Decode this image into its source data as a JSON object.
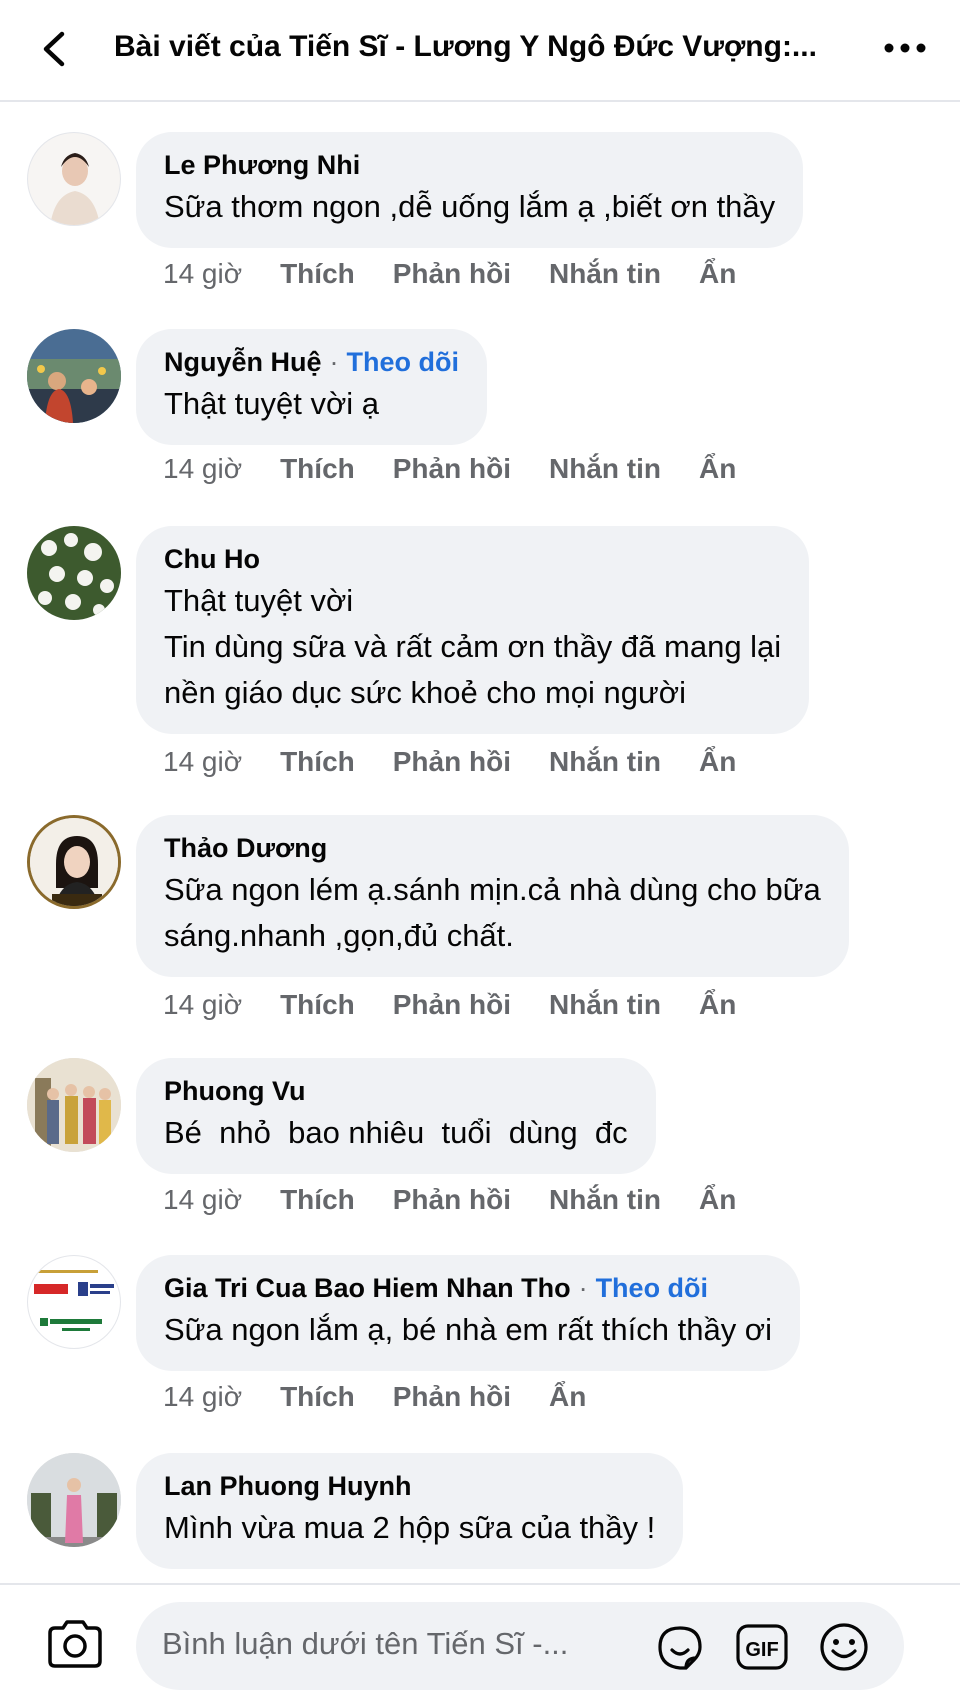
{
  "header": {
    "title": "Bài viết của Tiến Sĩ - Lương Y Ngô Đức Vượng:...",
    "back_icon": "chevron-left-icon",
    "more_icon": "more-dots-icon"
  },
  "actions": {
    "time": "14 giờ",
    "like": "Thích",
    "reply": "Phản hồi",
    "message": "Nhắn tin",
    "hide": "Ẩn"
  },
  "follow_label": "Theo dõi",
  "separator": "·",
  "comments": [
    {
      "name": "Le Phương Nhi",
      "lines": [
        "Sữa thơm ngon ,dễ uống lắm ạ ,biết ơn thầy"
      ]
    },
    {
      "name": "Nguyễn Huệ",
      "follow": true,
      "lines": [
        "Thật tuyệt vời ạ"
      ]
    },
    {
      "name": "Chu Ho",
      "lines": [
        "Thật tuyệt vời",
        "Tin dùng sữa và rất cảm ơn thầy đã mang lại",
        "nền giáo dục sức khoẻ cho mọi người"
      ]
    },
    {
      "name": "Thảo Dương",
      "lines": [
        "Sữa ngon lém ạ.sánh mịn.cả nhà dùng cho bữa",
        "sáng.nhanh ,gọn,đủ chất."
      ]
    },
    {
      "name": "Phuong Vu",
      "lines": [
        "Bé  nhỏ  bao nhiêu  tuổi  dùng  đc"
      ]
    },
    {
      "name": "Gia Tri Cua Bao Hiem Nhan Tho",
      "follow": true,
      "lines": [
        "Sữa ngon lắm ạ, bé nhà em rất thích thầy ơi"
      ]
    },
    {
      "name": "Lan Phuong Huynh",
      "lines": [
        "Mình vừa mua 2 hộp sữa của thầy !"
      ]
    }
  ],
  "composer": {
    "placeholder": "Bình luận dưới tên Tiến Sĩ -...",
    "camera_icon": "camera-icon",
    "sticker_icon": "sticker-icon",
    "gif_label": "GIF",
    "emoji_icon": "emoji-icon"
  },
  "colors": {
    "bubble": "#f0f2f5",
    "follow": "#216fdb",
    "muted": "#65676b",
    "text": "#050505"
  }
}
